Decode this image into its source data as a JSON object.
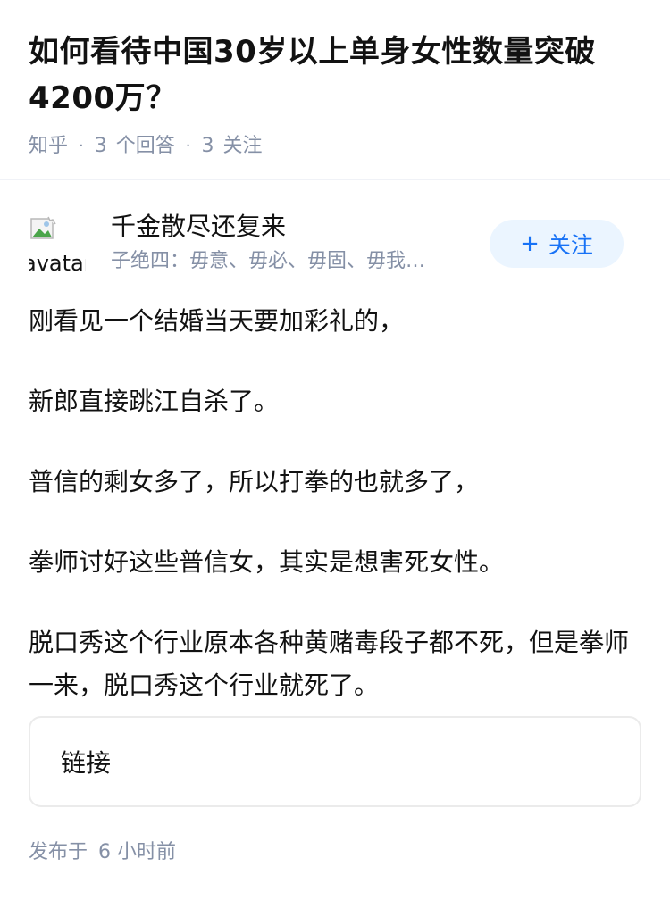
{
  "question": {
    "title": "如何看待中国30岁以上单身女性数量突破4200万？",
    "source": "知乎",
    "answer_count": "3",
    "answer_label": "个回答",
    "follow_count": "3",
    "follow_label": "关注"
  },
  "author": {
    "avatar_alt": "avatar",
    "name": "千金散尽还复来",
    "bio": "子绝四：毋意、毋必、毋固、毋我…",
    "follow_button_label": "关注",
    "follow_button_icon": "plus-icon"
  },
  "answer": {
    "paragraphs": [
      "刚看见一个结婚当天要加彩礼的，",
      "新郎直接跳江自杀了。",
      "普信的剩女多了，所以打拳的也就多了，",
      "拳师讨好这些普信女，其实是想害死女性。",
      "脱口秀这个行业原本各种黄赌毒段子都不死，但是拳师一来，脱口秀这个行业就死了。"
    ],
    "link_card_label": "链接",
    "publish_label": "发布于",
    "publish_time": "6 小时前"
  },
  "colors": {
    "accent": "#1772f6",
    "accent_bg": "#ebf5ff",
    "meta_gray": "#8590a6",
    "text": "#121212"
  }
}
